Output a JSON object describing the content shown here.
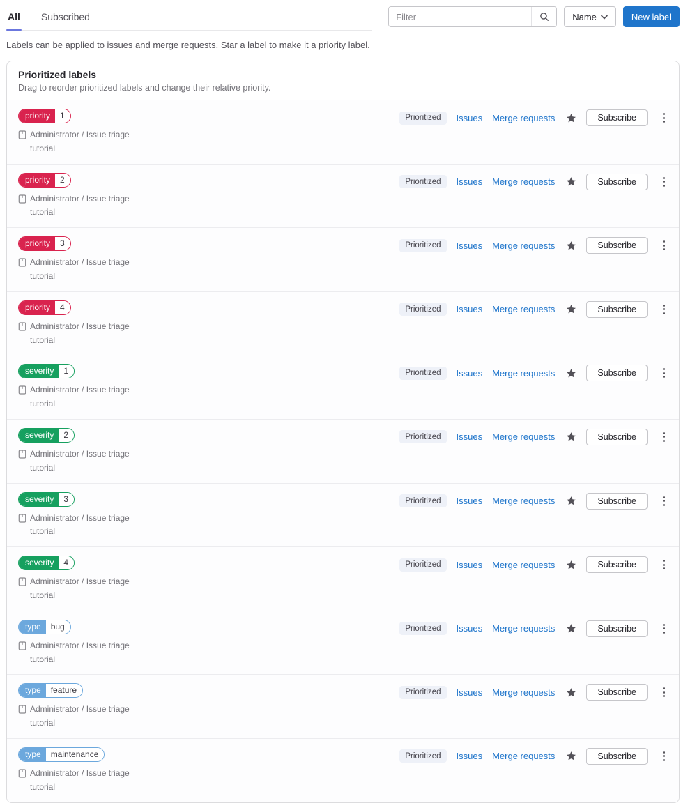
{
  "tabs": {
    "all": "All",
    "subscribed": "Subscribed"
  },
  "toolbar": {
    "filter_placeholder": "Filter",
    "sort_label": "Name",
    "new_label": "New label"
  },
  "intro": "Labels can be applied to issues and merge requests. Star a label to make it a priority label.",
  "card": {
    "title": "Prioritized labels",
    "subtitle": "Drag to reorder prioritized labels and change their relative priority."
  },
  "row_actions": {
    "prioritized": "Prioritized",
    "issues": "Issues",
    "merge_requests": "Merge requests",
    "subscribe": "Subscribe"
  },
  "project_path": "Administrator / Issue triage tutorial",
  "colors": {
    "priority_red": "#d9234e",
    "severity_green": "#16a05f",
    "type_blue": "#6ca8dd",
    "accent_blue": "#1f75cb",
    "tab_indicator": "#6b77de",
    "star_gray": "#535158"
  },
  "labels": [
    {
      "scope": "priority",
      "value": "1",
      "color": "#d9234e"
    },
    {
      "scope": "priority",
      "value": "2",
      "color": "#d9234e"
    },
    {
      "scope": "priority",
      "value": "3",
      "color": "#d9234e"
    },
    {
      "scope": "priority",
      "value": "4",
      "color": "#d9234e"
    },
    {
      "scope": "severity",
      "value": "1",
      "color": "#16a05f"
    },
    {
      "scope": "severity",
      "value": "2",
      "color": "#16a05f"
    },
    {
      "scope": "severity",
      "value": "3",
      "color": "#16a05f"
    },
    {
      "scope": "severity",
      "value": "4",
      "color": "#16a05f"
    },
    {
      "scope": "type",
      "value": "bug",
      "color": "#6ca8dd"
    },
    {
      "scope": "type",
      "value": "feature",
      "color": "#6ca8dd"
    },
    {
      "scope": "type",
      "value": "maintenance",
      "color": "#6ca8dd"
    }
  ]
}
